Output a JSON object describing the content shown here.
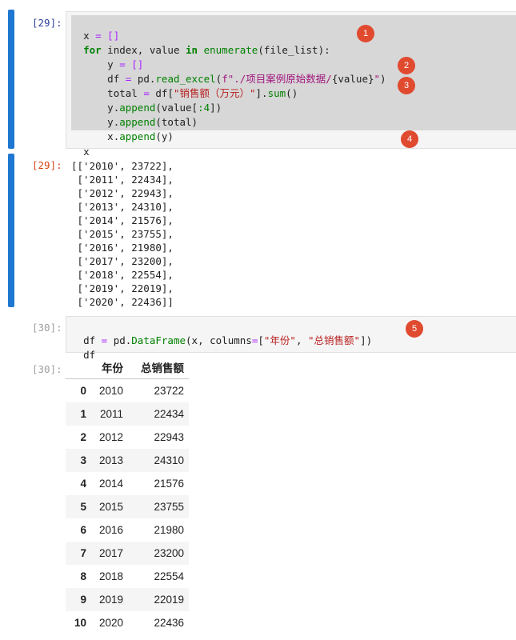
{
  "cells": {
    "cell1": {
      "prompt_in": "[29]:",
      "prompt_out": "[29]:",
      "code": {
        "l1_a": "x",
        "l1_b": " = ",
        "l1_c": "[]",
        "l2_kw1": "for",
        "l2_a": " index, value ",
        "l2_kw2": "in",
        "l2_fn": "enumerate",
        "l2_b": "(file_list):",
        "l3_a": "    y ",
        "l3_b": "= ",
        "l3_c": "[]",
        "l4_a": "    df ",
        "l4_b": "= ",
        "l4_c": "pd.",
        "l4_fn": "read_excel",
        "l4_d": "(",
        "l4_str": "f\"./项目案例原始数据/",
        "l4_e": "{value}",
        "l4_str2": "\"",
        "l4_f": ")",
        "l5_a": "    total ",
        "l5_b": "= ",
        "l5_c": "df[",
        "l5_str": "\"销售额（万元）\"",
        "l5_d": "].",
        "l5_fn": "sum",
        "l5_e": "()",
        "l6_a": "    y.",
        "l6_fn": "append",
        "l6_b": "(value[",
        "l6_num": ":4",
        "l6_c": "])",
        "l7_a": "    y.",
        "l7_fn": "append",
        "l7_b": "(total)",
        "l8_a": "    x.",
        "l8_fn": "append",
        "l8_b": "(y)",
        "l9": "x"
      },
      "output_lines": [
        "[['2010', 23722],",
        " ['2011', 22434],",
        " ['2012', 22943],",
        " ['2013', 24310],",
        " ['2014', 21576],",
        " ['2015', 23755],",
        " ['2016', 21980],",
        " ['2017', 23200],",
        " ['2018', 22554],",
        " ['2019', 22019],",
        " ['2020', 22436]]"
      ]
    },
    "cell2": {
      "prompt_in": "[30]:",
      "prompt_out": "[30]:",
      "code": {
        "l1_a": "df ",
        "l1_b": "= ",
        "l1_c": "pd.",
        "l1_fn": "DataFrame",
        "l1_d": "(x, columns",
        "l1_e": "=",
        "l1_f": "[",
        "l1_s1": "\"年份\"",
        "l1_g": ", ",
        "l1_s2": "\"总销售额\"",
        "l1_h": "])",
        "l2": "df"
      },
      "table": {
        "headers": [
          "年份",
          "总销售额"
        ],
        "rows": [
          {
            "idx": "0",
            "year": "2010",
            "sales": "23722"
          },
          {
            "idx": "1",
            "year": "2011",
            "sales": "22434"
          },
          {
            "idx": "2",
            "year": "2012",
            "sales": "22943"
          },
          {
            "idx": "3",
            "year": "2013",
            "sales": "24310"
          },
          {
            "idx": "4",
            "year": "2014",
            "sales": "21576"
          },
          {
            "idx": "5",
            "year": "2015",
            "sales": "23755"
          },
          {
            "idx": "6",
            "year": "2016",
            "sales": "21980"
          },
          {
            "idx": "7",
            "year": "2017",
            "sales": "23200"
          },
          {
            "idx": "8",
            "year": "2018",
            "sales": "22554"
          },
          {
            "idx": "9",
            "year": "2019",
            "sales": "22019"
          },
          {
            "idx": "10",
            "year": "2020",
            "sales": "22436"
          }
        ]
      }
    }
  },
  "badges": [
    "1",
    "2",
    "3",
    "4",
    "5"
  ],
  "colors": {
    "selection_bar": "#1e78d2",
    "badge": "#e04a2f",
    "in_prompt": "#303f9f",
    "out_prompt": "#d84315"
  }
}
